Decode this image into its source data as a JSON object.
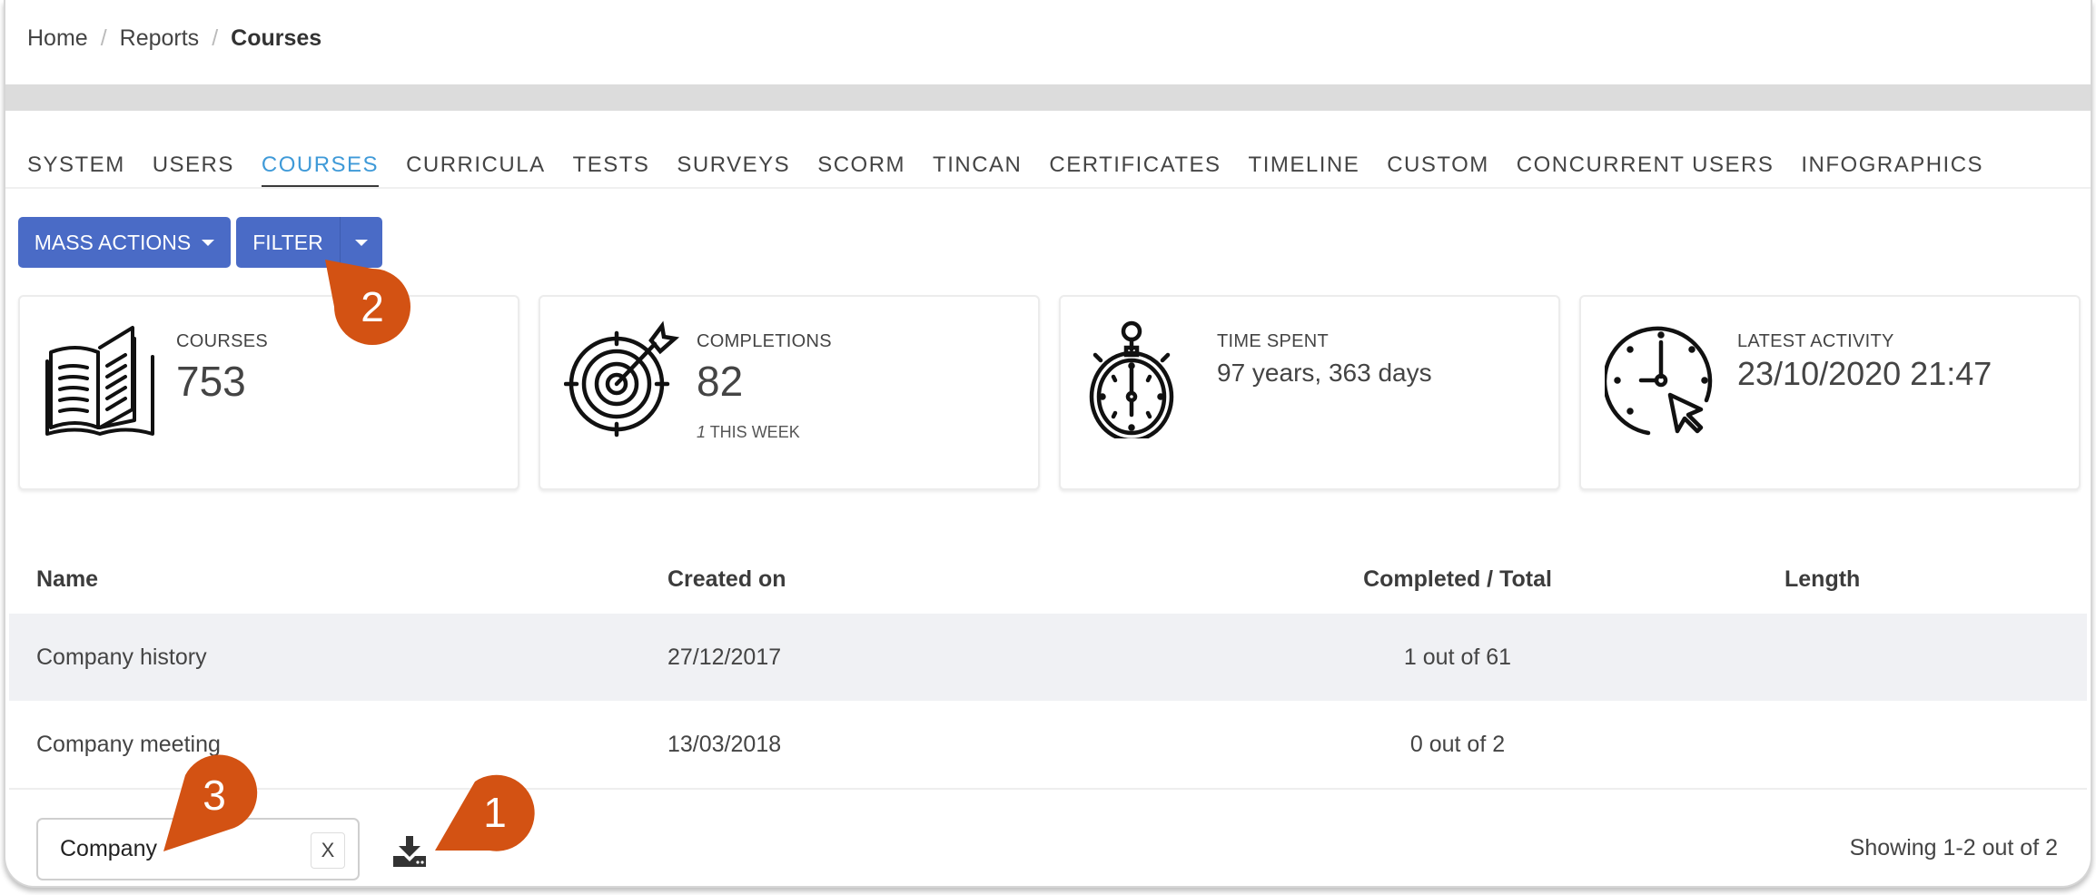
{
  "breadcrumb": {
    "items": [
      "Home",
      "Reports"
    ],
    "current": "Courses",
    "separator": "/"
  },
  "tabs": [
    {
      "label": "SYSTEM",
      "active": false
    },
    {
      "label": "USERS",
      "active": false
    },
    {
      "label": "COURSES",
      "active": true
    },
    {
      "label": "CURRICULA",
      "active": false
    },
    {
      "label": "TESTS",
      "active": false
    },
    {
      "label": "SURVEYS",
      "active": false
    },
    {
      "label": "SCORM",
      "active": false
    },
    {
      "label": "TINCAN",
      "active": false
    },
    {
      "label": "CERTIFICATES",
      "active": false
    },
    {
      "label": "TIMELINE",
      "active": false
    },
    {
      "label": "CUSTOM",
      "active": false
    },
    {
      "label": "CONCURRENT USERS",
      "active": false
    },
    {
      "label": "INFOGRAPHICS",
      "active": false
    }
  ],
  "toolbar": {
    "mass_actions_label": "MASS ACTIONS",
    "filter_label": "FILTER"
  },
  "stats": {
    "courses": {
      "label": "COURSES",
      "value": "753",
      "icon": "open-book-icon"
    },
    "completions": {
      "label": "COMPLETIONS",
      "value": "82",
      "sub_number": "1",
      "sub_text": " THIS WEEK",
      "icon": "target-icon"
    },
    "time_spent": {
      "label": "TIME SPENT",
      "value": "97 years, 363 days",
      "icon": "stopwatch-icon"
    },
    "latest_activity": {
      "label": "LATEST ACTIVITY",
      "value": "23/10/2020 21:47",
      "icon": "clock-cursor-icon"
    }
  },
  "table": {
    "columns": [
      "Name",
      "Created on",
      "Completed / Total",
      "Length"
    ],
    "rows": [
      {
        "name": "Company history",
        "created_on": "27/12/2017",
        "completed_total": "1 out of 61",
        "length": ""
      },
      {
        "name": "Company meeting",
        "created_on": "13/03/2018",
        "completed_total": "0 out of 2",
        "length": ""
      }
    ]
  },
  "footer": {
    "search_value": "Company",
    "clear_label": "X",
    "showing_text": "Showing 1-2 out of 2"
  },
  "callouts": {
    "one": "1",
    "two": "2",
    "three": "3"
  },
  "colors": {
    "primary_button": "#4a6bc6",
    "active_tab": "#3f9ad8",
    "callout": "#d35213",
    "row_highlight": "#f0f1f4"
  }
}
